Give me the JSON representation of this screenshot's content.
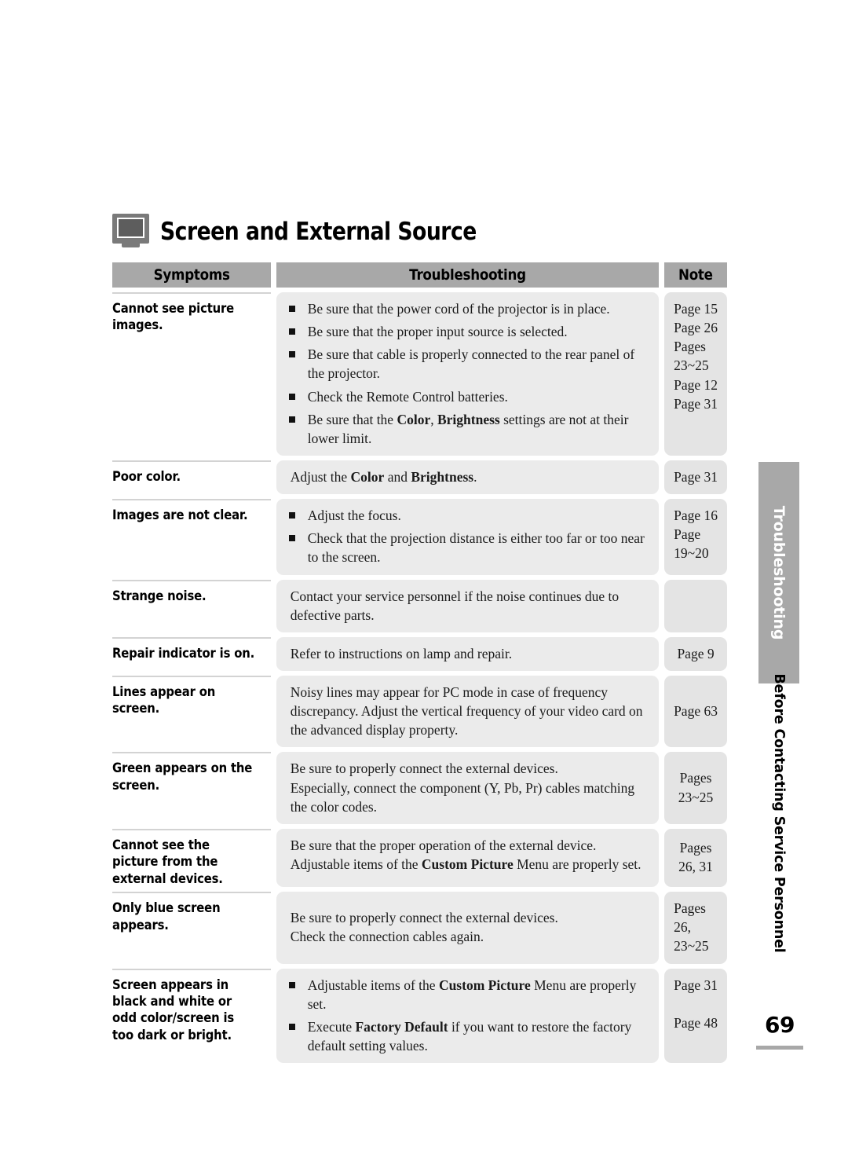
{
  "section": {
    "icon": "monitor-icon",
    "title": "Screen and External Source"
  },
  "table": {
    "headers": {
      "symptoms": "Symptoms",
      "troubleshooting": "Troubleshooting",
      "note": "Note"
    },
    "rows": [
      {
        "symptom": "Cannot see picture images.",
        "items": [
          "Be sure that the power cord of the projector is in place.",
          "Be sure that the proper input source is selected.",
          "Be sure that cable is properly connected to the rear panel of the projector.",
          "Check the Remote Control batteries.",
          "Be sure that the Color, Brightness settings are not at their lower limit."
        ],
        "notes": [
          "Page 15",
          "Page 26",
          "Pages",
          "23~25",
          "Page 12",
          "Page 31"
        ]
      },
      {
        "symptom": "Poor color.",
        "paragraphs": [
          "Adjust the Color and Brightness."
        ],
        "notes": [
          "Page 31"
        ]
      },
      {
        "symptom": "Images are not clear.",
        "items": [
          "Adjust the focus.",
          "Check that the projection distance is either too far or too near to the screen."
        ],
        "notes": [
          "Page 16",
          "Page",
          "19~20"
        ]
      },
      {
        "symptom": "Strange noise.",
        "paragraphs": [
          "Contact your service personnel if the noise continues due to defective parts."
        ],
        "notes": []
      },
      {
        "symptom": "Repair indicator is on.",
        "paragraphs": [
          "Refer to instructions on lamp and repair."
        ],
        "notes": [
          "Page 9"
        ]
      },
      {
        "symptom": "Lines appear on screen.",
        "paragraphs": [
          "Noisy lines may appear for PC mode in case of frequency discrepancy. Adjust the vertical frequency of your video card on the advanced display property."
        ],
        "notes": [
          "Page 63"
        ]
      },
      {
        "symptom": "Green appears on the screen.",
        "paragraphs": [
          "Be sure to properly connect the external devices.",
          "Especially, connect the component (Y, Pb, Pr) cables matching the color codes."
        ],
        "notes": [
          "Pages",
          "23~25"
        ]
      },
      {
        "symptom": "Cannot see the picture from the external devices.",
        "paragraphs": [
          "Be sure that the proper operation of the external device.",
          "Adjustable items of the Custom Picture Menu are properly set."
        ],
        "notes": [
          "Pages",
          "26, 31"
        ]
      },
      {
        "symptom": "Only blue screen appears.",
        "paragraphs": [
          "Be sure to properly connect the external devices.",
          "Check the connection cables again."
        ],
        "notes": [
          "Pages",
          "26,",
          "23~25"
        ]
      },
      {
        "symptom": "Screen appears in black and white or odd color/screen is too dark or bright.",
        "items": [
          "Adjustable items of the  Custom Picture Menu are properly set.",
          "Execute Factory Default if you want to restore the factory default setting values."
        ],
        "notes": [
          "Page 31",
          "Page 48"
        ]
      }
    ]
  },
  "side": {
    "tab_label": "Troubleshooting",
    "chapter_label": "Before Contacting Service Personnel"
  },
  "footer": {
    "page_number": "69"
  },
  "colors": {
    "header_gray": "#a8a8a8",
    "cell_gray": "#ebebeb",
    "note_gray": "#e4e4e4",
    "rule_gray": "#d3d3d3"
  }
}
